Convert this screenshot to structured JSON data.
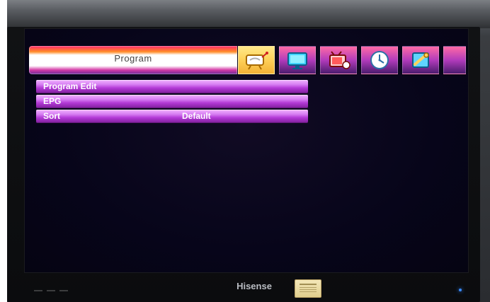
{
  "menu": {
    "title": "Program",
    "tabs": [
      {
        "name": "program",
        "icon": "program-icon"
      },
      {
        "name": "picture",
        "icon": "monitor-icon"
      },
      {
        "name": "channel",
        "icon": "tv-icon"
      },
      {
        "name": "time",
        "icon": "clock-icon"
      },
      {
        "name": "setup",
        "icon": "tools-icon"
      }
    ],
    "items": [
      {
        "label": "Program Edit",
        "value": ""
      },
      {
        "label": "EPG",
        "value": ""
      },
      {
        "label": "Sort",
        "value": "Default"
      }
    ]
  },
  "tv": {
    "brand": "Hisense"
  },
  "colors": {
    "menu_purple": "#b33ad6",
    "active_tab": "#ffd35c",
    "screen_bg": "#07051a"
  }
}
